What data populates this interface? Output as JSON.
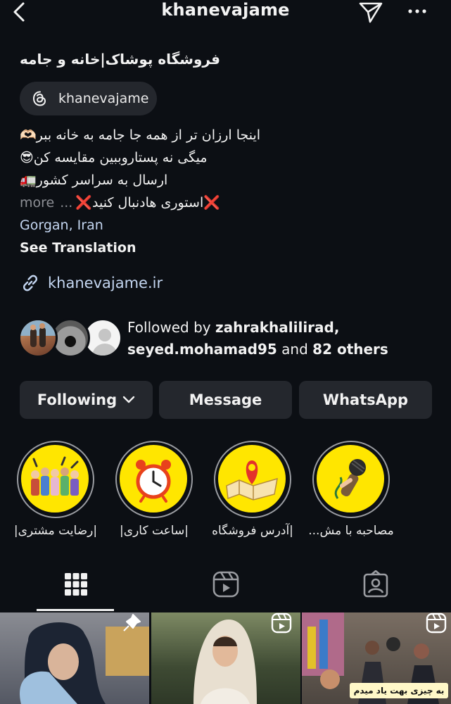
{
  "header": {
    "username": "khanevajame"
  },
  "profile": {
    "shop_name": "فروشگاه پوشاک|خانه و جامه",
    "threads_handle": "khanevajame",
    "bio_lines": [
      "اینجا ارزان تر از همه جا جامه به خانه ببر🫶🏻",
      "میگی نه پستاروببین مقایسه کن😎",
      "ارسال به سراسر کشور🚛"
    ],
    "bio_last_line": "❌استوری هادنبال کنید❌",
    "bio_ellipsis": "...",
    "more_label": "more",
    "location": "Gorgan, Iran",
    "see_translation": "See Translation",
    "website": "khanevajame.ir"
  },
  "followed_by": {
    "prefix": "Followed by",
    "user1": "zahrakhalilirad,",
    "user2": "seyed.mohamad95",
    "and": "and",
    "others": "82 others"
  },
  "actions": {
    "following": "Following",
    "message": "Message",
    "whatsapp": "WhatsApp"
  },
  "highlights": [
    {
      "label": "|رضایت مشتری|",
      "icon": "customers-icon"
    },
    {
      "label": "|ساعت کاری|",
      "icon": "alarm-clock-icon"
    },
    {
      "label": "|آدرس فروشگاه",
      "icon": "map-pin-icon"
    },
    {
      "label": "مصاحبه با مش...",
      "icon": "microphone-icon"
    }
  ],
  "tabs": [
    "grid-tab",
    "reels-tab",
    "tagged-tab"
  ],
  "posts": {
    "post3_caption": "به چیزی بهت یاد میدم"
  },
  "colors": {
    "background": "#0c0f14",
    "button": "#24272d",
    "link": "#c4d6f1",
    "highlight_yellow": "#ffe600"
  }
}
